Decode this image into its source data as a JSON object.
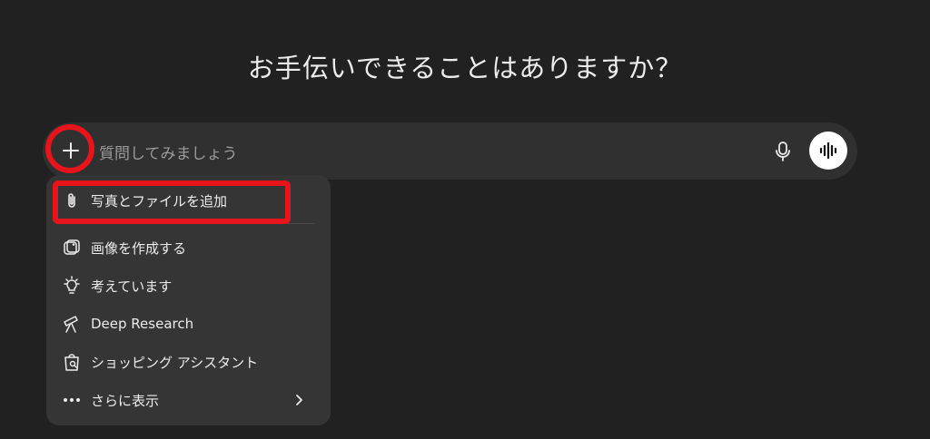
{
  "headline": "お手伝いできることはありますか？",
  "composer": {
    "placeholder": "質問してみましょう"
  },
  "menu": {
    "items": [
      {
        "label": "写真とファイルを追加",
        "icon": "paperclip-icon"
      },
      {
        "label": "画像を作成する",
        "icon": "image-create-icon"
      },
      {
        "label": "考えています",
        "icon": "lightbulb-icon"
      },
      {
        "label": "Deep Research",
        "icon": "telescope-icon"
      },
      {
        "label": "ショッピング アシスタント",
        "icon": "shopping-bag-icon"
      },
      {
        "label": "さらに表示",
        "icon": "more-dots-icon"
      }
    ]
  },
  "colors": {
    "background": "#212121",
    "composer": "#303030",
    "menu": "#353535",
    "annotation": "#e8141b"
  }
}
